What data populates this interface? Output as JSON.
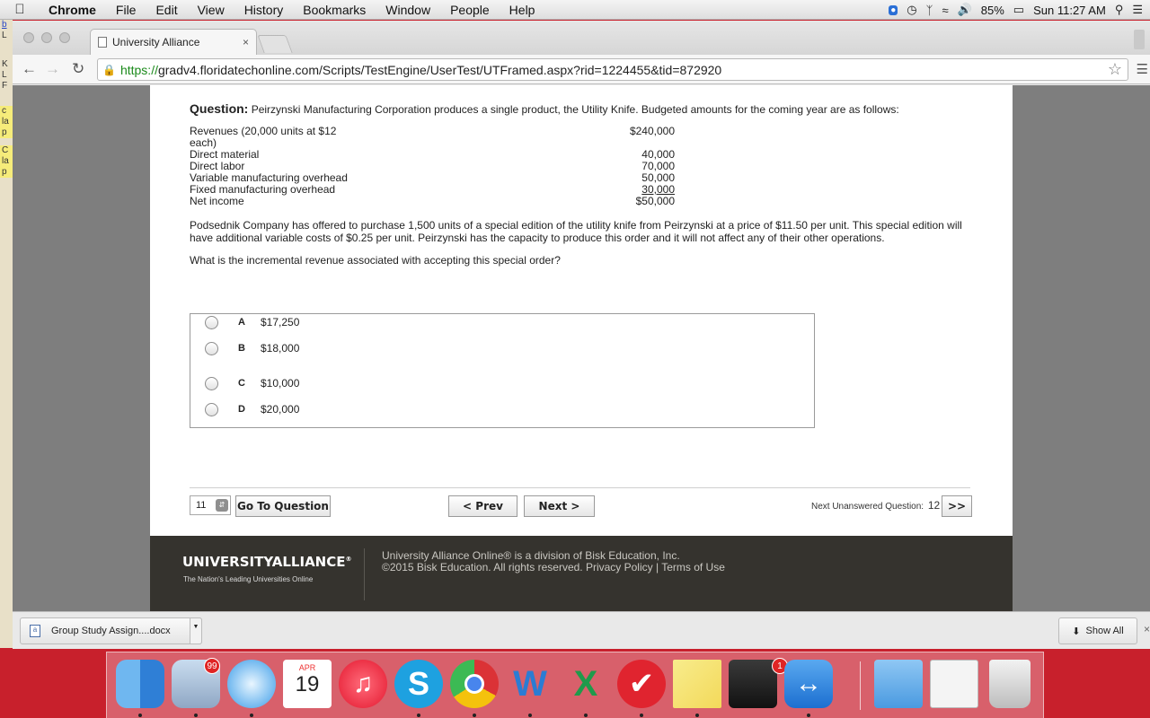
{
  "menubar": {
    "apple": "",
    "app_name": "Chrome",
    "items": [
      "File",
      "Edit",
      "View",
      "History",
      "Bookmarks",
      "Window",
      "People",
      "Help"
    ],
    "battery": "85%",
    "clock": "Sun 11:27 AM"
  },
  "desktop_strip": [
    "b",
    "L",
    "K",
    "L",
    "F",
    "c",
    "la",
    "p",
    "C",
    "la",
    "p"
  ],
  "browser": {
    "tab_title": "University Alliance",
    "tab_close": "×",
    "url_scheme": "https://",
    "url_rest": "gradv4.floridatechonline.com/Scripts/TestEngine/UserTest/UTFramed.aspx?rid=1224455&tid=872920"
  },
  "question": {
    "label": "Question:",
    "text": "Peirzynski Manufacturing Corporation produces a single product, the Utility Knife. Budgeted amounts for the coming year are as follows:",
    "budget": [
      {
        "label": "Revenues (20,000 units at $12 each)",
        "value": "$240,000"
      },
      {
        "label": "Direct material",
        "value": "40,000"
      },
      {
        "label": "Direct labor",
        "value": "70,000"
      },
      {
        "label": "Variable manufacturing overhead",
        "value": "50,000"
      },
      {
        "label": "Fixed manufacturing overhead",
        "value": "30,000"
      },
      {
        "label": "Net income",
        "value": "$50,000"
      }
    ],
    "offer": "Podsednik Company has offered to purchase 1,500 units of a special edition of the utility knife from Peirzynski at a price of $11.50 per unit. This special edition will have additional variable costs of $0.25 per unit. Peirzynski has the capacity to produce this order and it will not affect any of their other operations.",
    "ask": "What is the incremental revenue associated with accepting this special order?"
  },
  "answers": [
    {
      "letter": "A",
      "text": "$17,250"
    },
    {
      "letter": "B",
      "text": "$18,000"
    },
    {
      "letter": "C",
      "text": "$10,000"
    },
    {
      "letter": "D",
      "text": "$20,000"
    }
  ],
  "navigation": {
    "question_number": "11",
    "go_to_label": "Go To Question",
    "prev_label": "< Prev",
    "next_label": "Next >",
    "next_unanswered_label": "Next Unanswered Question:",
    "next_unanswered_number": "12",
    "skip_label": ">>"
  },
  "footer": {
    "logo_bold": "UNIVERSITY",
    "logo_rest": "ALLIANCE",
    "logo_mark": "®",
    "tagline": "The Nation's Leading Universities Online",
    "line1": "University Alliance Online® is a division of Bisk Education, Inc.",
    "line2": "©2015 Bisk Education. All rights reserved. Privacy Policy | Terms of Use"
  },
  "downloads": {
    "file_name": "Group Study Assign....docx",
    "show_all": "Show All",
    "close": "×"
  },
  "dock": {
    "mail_badge": "99",
    "calendar_month": "APR",
    "calendar_day": "19",
    "itunes_badge": "1",
    "icons": [
      "finder-icon",
      "mail-icon",
      "safari-icon",
      "calendar-icon",
      "itunes-icon",
      "skype-icon",
      "chrome-icon",
      "word-icon",
      "excel-icon",
      "wunderlist-icon",
      "stickies-icon",
      "printer-icon",
      "teamviewer-icon",
      "applications-folder-icon",
      "screenshot-icon",
      "trash-icon"
    ]
  }
}
